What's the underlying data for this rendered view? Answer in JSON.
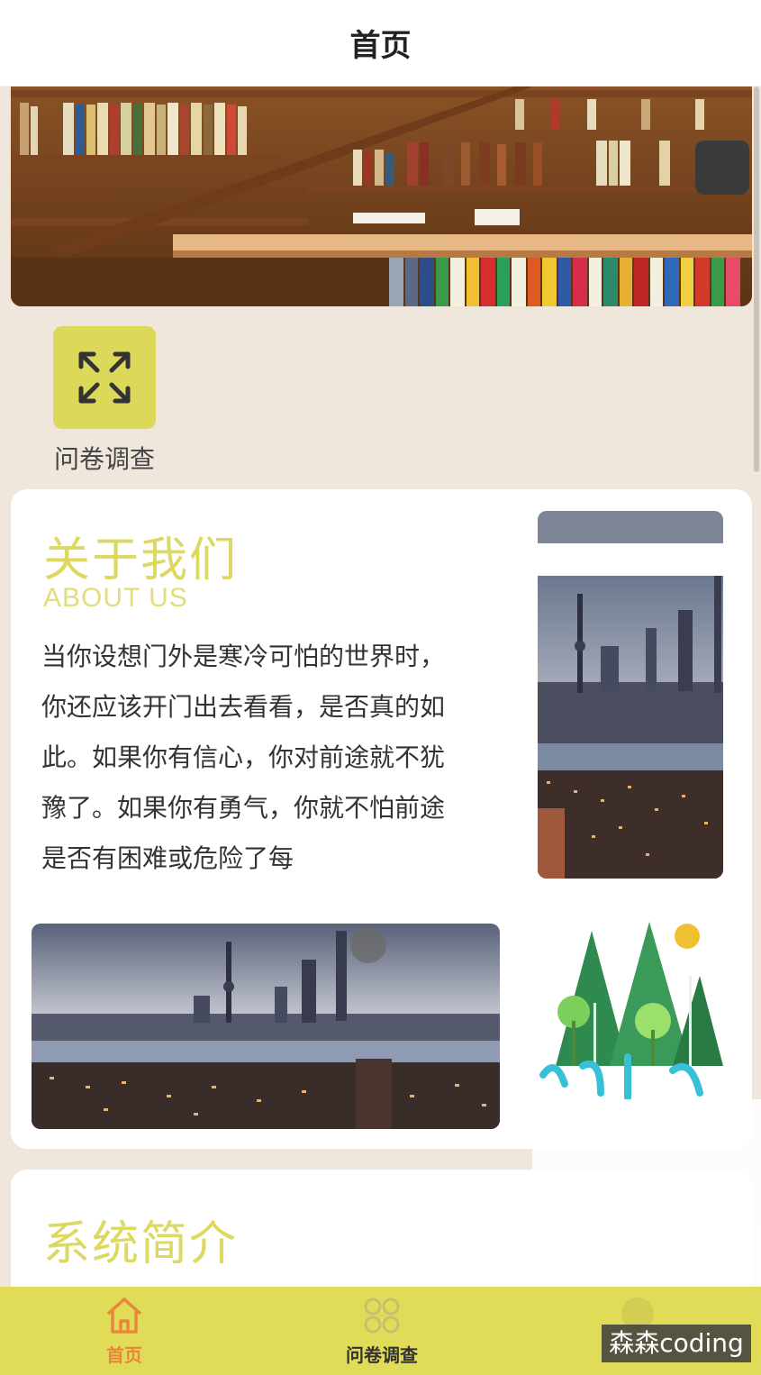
{
  "header": {
    "title": "首页"
  },
  "entries": [
    {
      "label": "问卷调查",
      "icon": "expand-arrows-icon"
    }
  ],
  "about": {
    "title_cn": "关于我们",
    "title_en": "ABOUT US",
    "text": "当你设想门外是寒冷可怕的世界时，你还应该开门出去看看，是否真的如此。如果你有信心，你对前途就不犹豫了。如果你有勇气，你就不怕前途是否有困难或危险了每"
  },
  "intro": {
    "title_cn": "系统简介"
  },
  "tabbar": {
    "items": [
      {
        "label": "首页",
        "icon": "home-icon",
        "active": true
      },
      {
        "label": "问卷调查",
        "icon": "grid-icon",
        "active": false
      }
    ]
  },
  "watermark": "森森coding",
  "colors": {
    "accent": "#dcd860",
    "tabbar": "#e0dc58",
    "active_tab": "#e8873a",
    "background": "#efe7dc"
  }
}
